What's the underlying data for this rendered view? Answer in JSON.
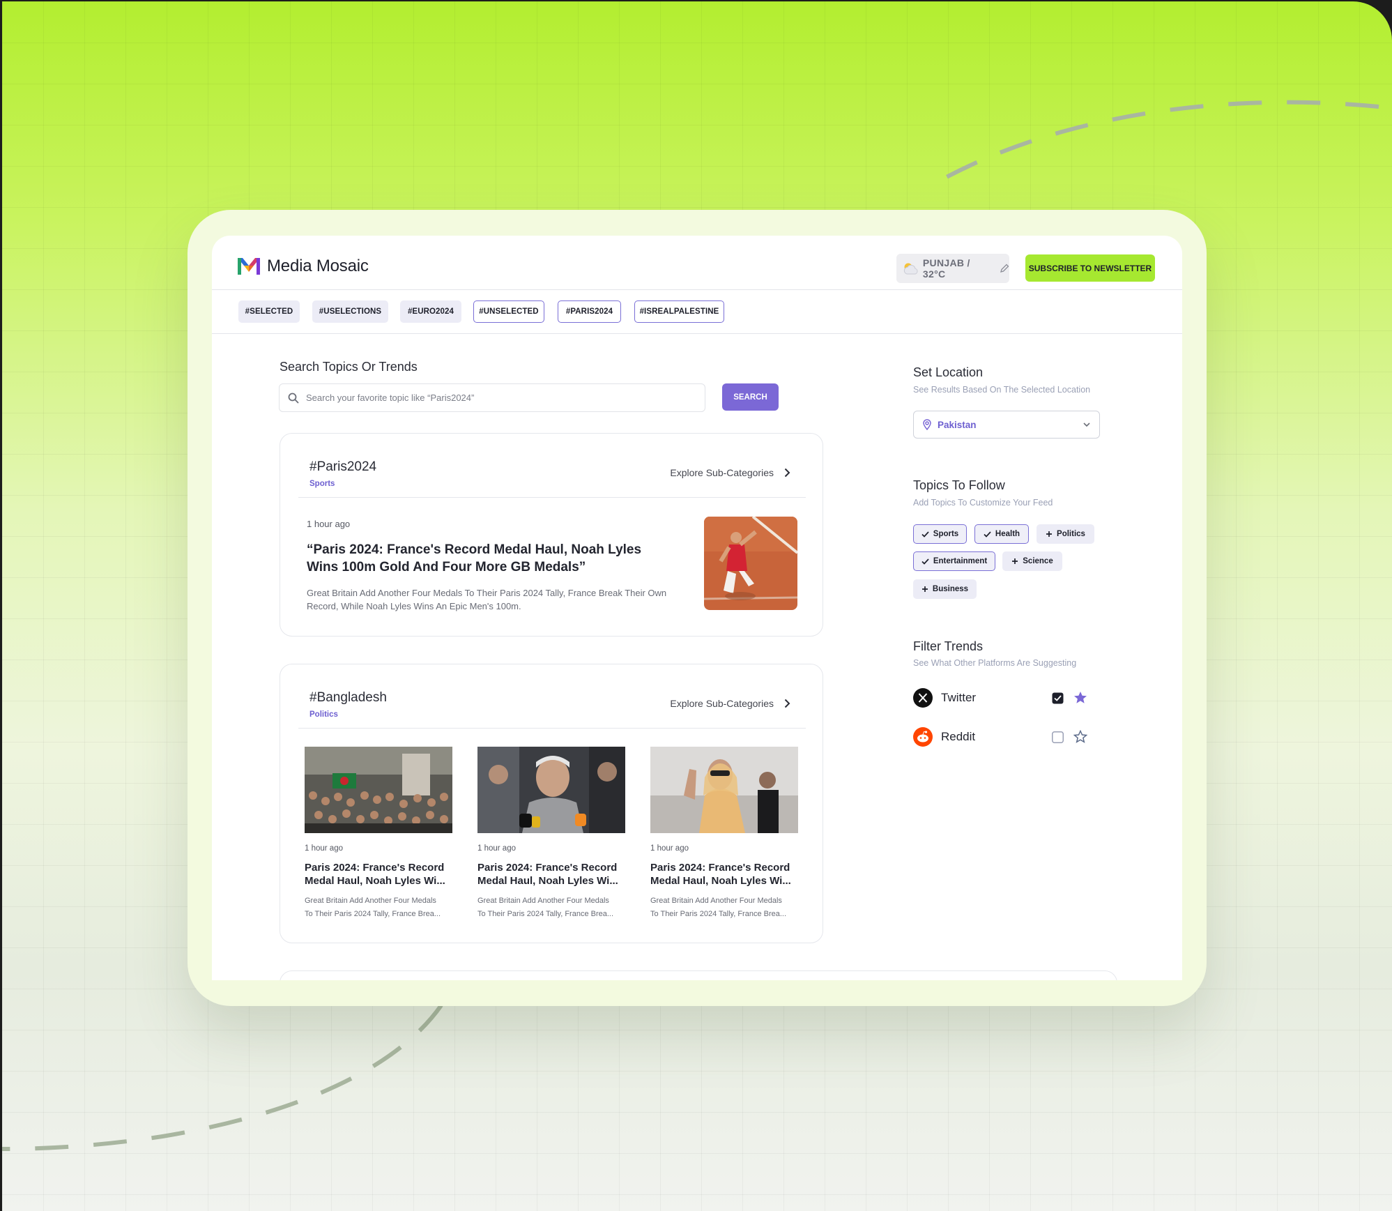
{
  "header": {
    "brand": "Media Mosaic",
    "weather": "PUNJAB / 32°C",
    "subscribe_label": "SUBSCRIBE TO NEWSLETTER"
  },
  "tags": [
    {
      "label": "#SELECTED",
      "state": "selected"
    },
    {
      "label": "#USELECTIONS",
      "state": "selected"
    },
    {
      "label": "#EURO2024",
      "state": "selected"
    },
    {
      "label": "#UNSELECTED",
      "state": "unselected"
    },
    {
      "label": "#PARIS2024",
      "state": "unselected"
    },
    {
      "label": "#ISREALPALESTINE",
      "state": "unselected"
    }
  ],
  "search": {
    "title": "Search Topics Or Trends",
    "placeholder": "Search your favorite topic like “Paris2024”",
    "button_label": "SEARCH"
  },
  "feed": [
    {
      "title": "#Paris2024",
      "category": "Sports",
      "explore_label": "Explore Sub-Categories",
      "story": {
        "time": "1 hour ago",
        "title": "“Paris 2024: France's Record Medal Haul, Noah Lyles Wins 100m Gold And Four More GB Medals”",
        "description": "Great Britain Add Another Four Medals To Their Paris 2024 Tally, France Break Their Own Record, While Noah Lyles Wins An Epic Men's 100m."
      }
    },
    {
      "title": "#Bangladesh",
      "category": "Politics",
      "explore_label": "Explore Sub-Categories",
      "stories": [
        {
          "time": "1 hour ago",
          "title": "Paris 2024: France's Record\nMedal Haul, Noah Lyles Wi...",
          "description": "Great Britain Add Another Four Medals\nTo Their Paris 2024 Tally, France Brea..."
        },
        {
          "time": "1 hour ago",
          "title": "Paris 2024: France's Record\nMedal Haul, Noah Lyles Wi...",
          "description": "Great Britain Add Another Four Medals\nTo Their Paris 2024 Tally, France Brea..."
        },
        {
          "time": "1 hour ago",
          "title": "Paris 2024: France's Record\nMedal Haul, Noah Lyles Wi...",
          "description": "Great Britain Add Another Four Medals\nTo Their Paris 2024 Tally, France Brea..."
        }
      ]
    }
  ],
  "sidebar": {
    "location": {
      "title": "Set Location",
      "subtitle": "See Results Based On The Selected Location",
      "selected": "Pakistan"
    },
    "topics": {
      "title": "Topics To Follow",
      "subtitle": "Add Topics To Customize Your Feed",
      "items": [
        {
          "label": "Sports",
          "followed": true
        },
        {
          "label": "Health",
          "followed": true
        },
        {
          "label": "Politics",
          "followed": false
        },
        {
          "label": "Entertainment",
          "followed": true
        },
        {
          "label": "Science",
          "followed": false
        },
        {
          "label": "Business",
          "followed": false
        }
      ]
    },
    "filters": {
      "title": "Filter Trends",
      "subtitle": "See What Other Platforms Are Suggesting",
      "platforms": [
        {
          "name": "Twitter",
          "checked": true,
          "starred": true,
          "icon": "x-logo-icon"
        },
        {
          "name": "Reddit",
          "checked": false,
          "starred": false,
          "icon": "reddit-logo-icon"
        }
      ]
    }
  },
  "colors": {
    "accent": "#7b68d6",
    "brand_green": "#a6e830"
  }
}
